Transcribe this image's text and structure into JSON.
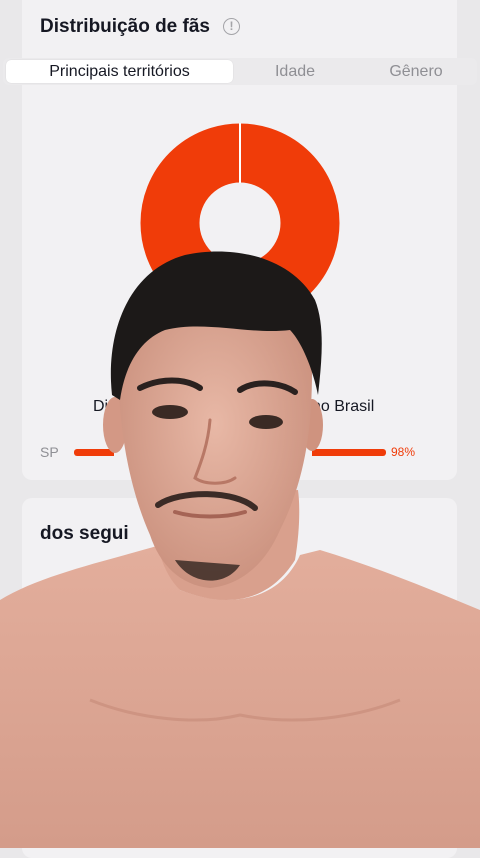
{
  "fan_distribution": {
    "title": "Distribuição de fãs",
    "info_icon": "info-icon",
    "tabs": [
      {
        "label": "Principais territórios",
        "active": true
      },
      {
        "label": "Idade",
        "active": false
      },
      {
        "label": "Gênero",
        "active": false
      }
    ],
    "donut": {
      "color": "#f03c09",
      "share_percent": 98
    },
    "legend": {
      "left_fragment": "Di",
      "right_fragment": "no Brasil"
    },
    "territory_row": {
      "label": "SP",
      "value": "98%",
      "share_percent": 98
    }
  },
  "followers_section": {
    "title_fragment": "dos segui"
  },
  "colors": {
    "accent": "#f03c09",
    "card": "#f2f1f3",
    "background": "#e9e8ea"
  }
}
